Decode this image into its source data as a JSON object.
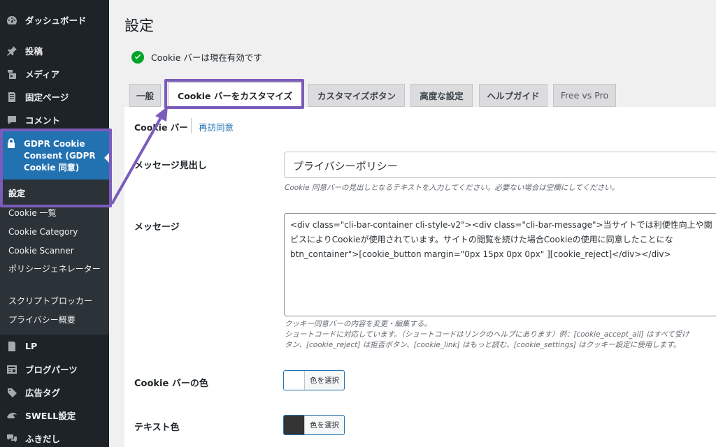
{
  "sidebar": {
    "items_top": [
      {
        "label": "ダッシュボード",
        "icon": "dashboard-icon"
      },
      {
        "label": "投稿",
        "icon": "pin-icon"
      },
      {
        "label": "メディア",
        "icon": "media-icon"
      },
      {
        "label": "固定ページ",
        "icon": "page-icon"
      },
      {
        "label": "コメント",
        "icon": "comment-icon"
      }
    ],
    "gdpr": {
      "label": "GDPR Cookie Consent (GDPR Cookie 同意)",
      "icon": "lock-icon"
    },
    "submenu": [
      {
        "label": "設定"
      },
      {
        "label": "Cookie 一覧"
      },
      {
        "label": "Cookie Category"
      },
      {
        "label": "Cookie Scanner"
      },
      {
        "label": "ポリシージェネレーター"
      },
      {
        "label": "スクリプトブロッカー"
      },
      {
        "label": "プライバシー概要"
      }
    ],
    "items_bottom": [
      {
        "label": "LP",
        "icon": "lp-icon"
      },
      {
        "label": "ブログパーツ",
        "icon": "blog-parts-icon"
      },
      {
        "label": "広告タグ",
        "icon": "ad-tag-icon"
      },
      {
        "label": "SWELL設定",
        "icon": "swell-icon"
      },
      {
        "label": "ふきだし",
        "icon": "balloon-icon"
      }
    ]
  },
  "page": {
    "title": "設定",
    "status": "Cookie バーは現在有効です"
  },
  "tabs": [
    {
      "label": "一般"
    },
    {
      "label": "Cookie バーをカスタマイズ"
    },
    {
      "label": "カスタマイズボタン"
    },
    {
      "label": "高度な設定"
    },
    {
      "label": "ヘルプガイド"
    },
    {
      "label": "Free vs Pro"
    }
  ],
  "subtabs": [
    {
      "label": "Cookie バー"
    },
    {
      "label": "再訪同意"
    }
  ],
  "form": {
    "heading_label": "メッセージ見出し",
    "heading_value": "プライバシーポリシー",
    "heading_help": "Cookie 同意バーの見出しとなるテキストを入力してください。必要ない場合は空欄にしてください。",
    "message_label": "メッセージ",
    "message_lines": [
      "<div class=\"cli-bar-container cli-style-v2\"><div class=\"cli-bar-message\">当サイトでは利便性向上や閲",
      "ビスによりCookieが使用されています。サイトの閲覧を続けた場合Cookieの使用に同意したことにな",
      "btn_container\">[cookie_button margin=\"0px 15px 0px 0px\" ][cookie_reject]</div></div>"
    ],
    "message_help": [
      "クッキー同意バーの内容を変更・編集する。",
      "ショートコードに対応しています。（ショートコードはリンクのヘルプにあります）例：[cookie_accept_all] はすべて受け",
      "タン、[cookie_reject] は拒否ボタン、[cookie_link] はもっと読む、[cookie_settings] はクッキー設定に使用します。"
    ],
    "bar_color_label": "Cookie バーの色",
    "bar_color_value": "#ffffff",
    "text_color_label": "テキスト色",
    "text_color_value": "#333333",
    "color_button_label": "色を選択"
  },
  "colors": {
    "sidebar_bg": "#1d2327",
    "submenu_bg": "#2c3338",
    "active_menu": "#2271b1",
    "highlight": "#7b5cba",
    "success": "#00a32a"
  }
}
